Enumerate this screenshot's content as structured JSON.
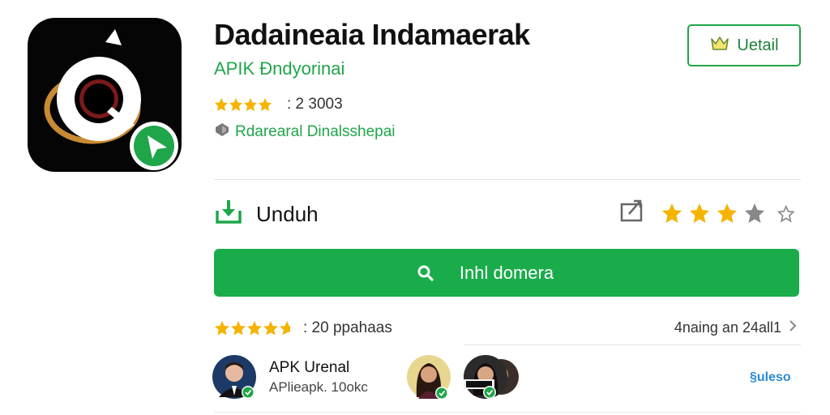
{
  "app": {
    "title": "Dadaineaia Indamaerak",
    "developer": "APIK Đndyorinai",
    "rating_count": ": 2 3003",
    "category": "Rdarearal Dinalsshepai"
  },
  "detail_button": {
    "label": "Uetail"
  },
  "unduh": {
    "label": "Unduh"
  },
  "user_rating": {
    "filled": 3,
    "empty": 2
  },
  "main_button": {
    "label": "Inhl domera"
  },
  "reviews": {
    "rating": 4.5,
    "count_text": ":  20 ppahaas",
    "link_text": "4naing an 24all1"
  },
  "author": {
    "name": "APK Urenal",
    "sub": "APlieapk. 10okc"
  },
  "more_link": "§uleso",
  "colors": {
    "green": "#1aac4b",
    "star": "#f5b400",
    "link": "#2a8ad6"
  }
}
